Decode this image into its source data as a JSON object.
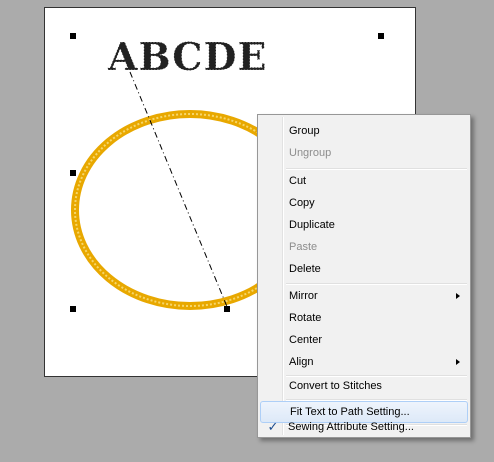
{
  "artwork": {
    "text": "ABCDE",
    "ellipse_color": "#e8a800"
  },
  "menu": {
    "items": [
      {
        "label": "Group",
        "disabled": false
      },
      {
        "label": "Ungroup",
        "disabled": true
      },
      {
        "label": "Cut",
        "disabled": false
      },
      {
        "label": "Copy",
        "disabled": false
      },
      {
        "label": "Duplicate",
        "disabled": false
      },
      {
        "label": "Paste",
        "disabled": true
      },
      {
        "label": "Delete",
        "disabled": false
      },
      {
        "label": "Mirror",
        "submenu": true
      },
      {
        "label": "Rotate",
        "disabled": false
      },
      {
        "label": "Center",
        "disabled": false
      },
      {
        "label": "Align",
        "submenu": true
      },
      {
        "label": "Convert to Stitches",
        "disabled": false
      },
      {
        "label": "Fit Text to Path Setting...",
        "highlighted": true
      },
      {
        "label": "Sewing Attribute Setting...",
        "checked": true
      }
    ],
    "check_mark": "✓"
  }
}
